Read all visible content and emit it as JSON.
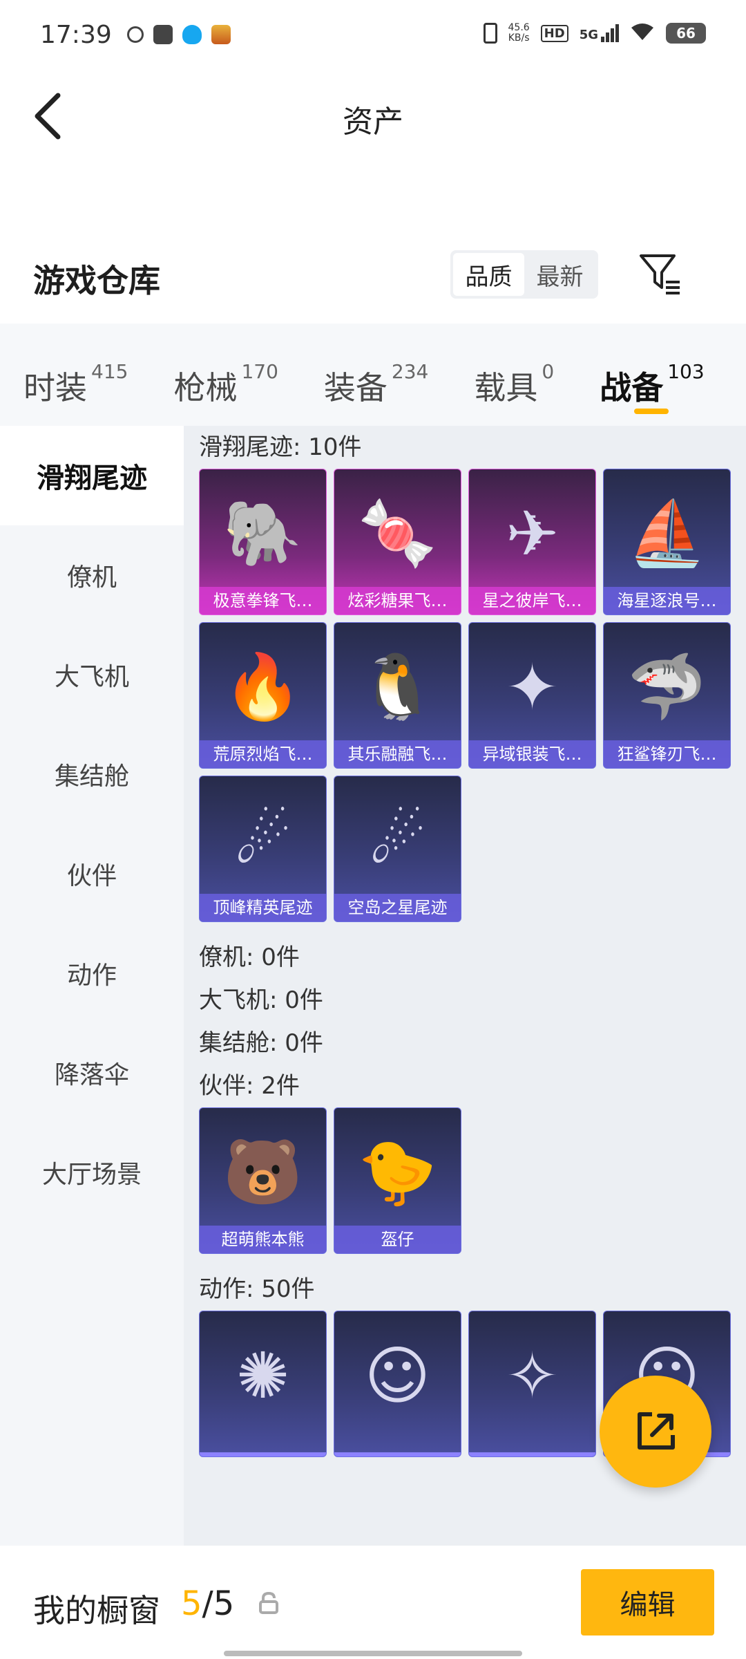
{
  "status_bar": {
    "time": "17:39",
    "speed_value": "45.6",
    "speed_unit": "KB/s",
    "hd_label": "HD",
    "network_label": "5G",
    "battery": "66"
  },
  "header": {
    "title": "资产"
  },
  "warehouse": {
    "title": "游戏仓库",
    "sort_options": [
      "品质",
      "最新"
    ],
    "sort_selected": "品质"
  },
  "tabs": [
    {
      "label": "时装",
      "count": "415"
    },
    {
      "label": "枪械",
      "count": "170"
    },
    {
      "label": "装备",
      "count": "234"
    },
    {
      "label": "载具",
      "count": "0"
    },
    {
      "label": "战备",
      "count": "103"
    }
  ],
  "active_tab": "战备",
  "sidebar": [
    {
      "label": "滑翔尾迹"
    },
    {
      "label": "僚机"
    },
    {
      "label": "大飞机"
    },
    {
      "label": "集结舱"
    },
    {
      "label": "伙伴"
    },
    {
      "label": "动作"
    },
    {
      "label": "降落伞"
    },
    {
      "label": "大厅场景"
    }
  ],
  "sections": [
    {
      "title": "滑翔尾迹: 10件",
      "items": [
        {
          "name": "极意拳锋飞…",
          "rarity": "pink",
          "icon": "elephant-glider-icon"
        },
        {
          "name": "炫彩糖果飞…",
          "rarity": "pink",
          "icon": "candy-glider-icon"
        },
        {
          "name": "星之彼岸飞…",
          "rarity": "pink",
          "icon": "dark-wing-glider-icon"
        },
        {
          "name": "海星逐浪号…",
          "rarity": "purple",
          "icon": "boat-glider-icon"
        },
        {
          "name": "荒原烈焰飞…",
          "rarity": "purple",
          "icon": "flame-glider-icon"
        },
        {
          "name": "其乐融融飞…",
          "rarity": "purple",
          "icon": "penguin-glider-icon"
        },
        {
          "name": "异域银装飞…",
          "rarity": "purple",
          "icon": "teal-wing-glider-icon"
        },
        {
          "name": "狂鲨锋刃飞…",
          "rarity": "purple",
          "icon": "shark-glider-icon"
        },
        {
          "name": "顶峰精英尾迹",
          "rarity": "purple",
          "icon": "rainbow-trail-icon"
        },
        {
          "name": "空岛之星尾迹",
          "rarity": "purple",
          "icon": "rainbow-trail-icon"
        }
      ]
    },
    {
      "title": "僚机: 0件",
      "items": []
    },
    {
      "title": "大飞机: 0件",
      "items": []
    },
    {
      "title": "集结舱: 0件",
      "items": []
    },
    {
      "title": "伙伴: 2件",
      "items": [
        {
          "name": "超萌熊本熊",
          "rarity": "purple",
          "icon": "bear-icon"
        },
        {
          "name": "盔仔",
          "rarity": "purple",
          "icon": "chick-helmet-icon"
        }
      ]
    },
    {
      "title": "动作: 50件",
      "items": [
        {
          "name": "",
          "rarity": "purple",
          "icon": "dance-poster-icon"
        },
        {
          "name": "",
          "rarity": "purple",
          "icon": "pose-figure-icon"
        },
        {
          "name": "",
          "rarity": "purple",
          "icon": "sparkle-pose-icon"
        },
        {
          "name": "",
          "rarity": "purple",
          "icon": "pose-figure-icon"
        }
      ]
    }
  ],
  "showcase": {
    "title": "我的橱窗",
    "current": "5",
    "separator": "/",
    "total": "5",
    "edit_label": "编辑"
  },
  "colors": {
    "accent": "#ffb400",
    "pink_rarity": "#c336b8",
    "purple_rarity": "#6c6fe0"
  }
}
